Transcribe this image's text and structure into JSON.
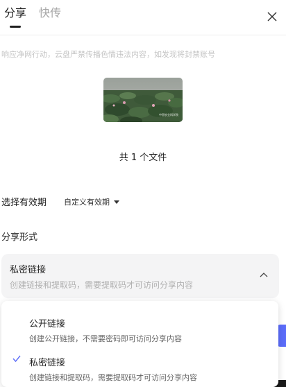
{
  "tabs": [
    {
      "label": "分享",
      "active": true
    },
    {
      "label": "快传",
      "active": false
    }
  ],
  "notice": "响应净网行动，云盘严禁传播色情违法内容，如发现将封禁账号",
  "thumbnail": {
    "caption": "中国农业科学院"
  },
  "file_count": "共 1 个文件",
  "expiry": {
    "label": "选择有效期",
    "value": "自定义有效期"
  },
  "share_method_label": "分享形式",
  "selected_link": {
    "title": "私密链接",
    "desc": "创建链接和提取码，需要提取码才可访问分享内容"
  },
  "dropdown_options": [
    {
      "title": "公开链接",
      "desc": "创建公开链接，不需要密码即可访问分享内容",
      "selected": false
    },
    {
      "title": "私密链接",
      "desc": "创建链接和提取码，需要提取码才可访问分享内容",
      "selected": true
    }
  ],
  "colors": {
    "accent": "#5b6cf9",
    "check": "#5b6cf9"
  }
}
